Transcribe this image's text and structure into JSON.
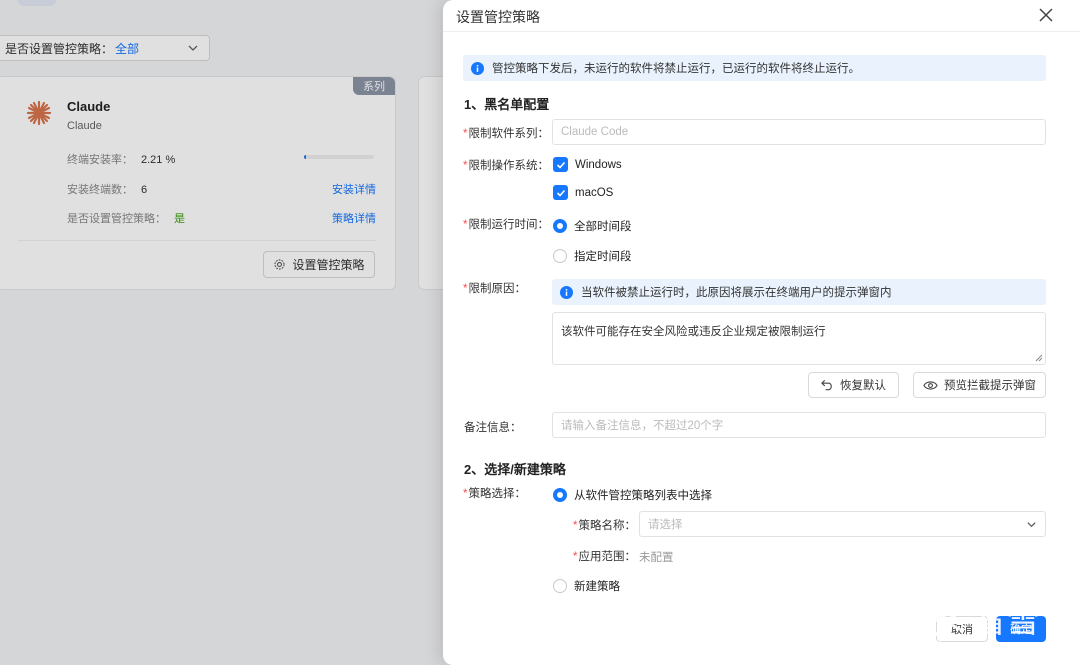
{
  "background": {
    "filter": {
      "label": "是否设置管控策略：",
      "value": "全部"
    },
    "card": {
      "tag": "系列",
      "name": "Claude",
      "subtitle": "Claude",
      "install_rate_label": "终端安装率：",
      "install_rate_value": "2.21 %",
      "install_rate_fraction": 0.0221,
      "install_count_label": "安装终端数：",
      "install_count_value": "6",
      "install_details_link": "安装详情",
      "policy_set_label": "是否设置管控策略：",
      "policy_set_value": "是",
      "policy_details_link": "策略详情",
      "set_policy_button": "设置管控策略"
    }
  },
  "drawer": {
    "title": "设置管控策略",
    "notice": "管控策略下发后，未运行的软件将禁止运行，已运行的软件将终止运行。",
    "section1_title": "1、黑名单配置",
    "software_series_label": "限制软件系列：",
    "software_series_placeholder": "Claude Code",
    "os_label": "限制操作系统：",
    "os_options": [
      {
        "label": "Windows",
        "checked": true
      },
      {
        "label": "macOS",
        "checked": true
      }
    ],
    "runtime_label": "限制运行时间：",
    "runtime_options": [
      {
        "label": "全部时间段",
        "selected": true
      },
      {
        "label": "指定时间段",
        "selected": false
      }
    ],
    "reason_label": "限制原因：",
    "reason_hint": "当软件被禁止运行时，此原因将展示在终端用户的提示弹窗内",
    "reason_value": "该软件可能存在安全风险或违反企业规定被限制运行",
    "restore_default_button": "恢复默认",
    "preview_popup_button": "预览拦截提示弹窗",
    "remark_label": "备注信息：",
    "remark_placeholder": "请输入备注信息，不超过20个字",
    "section2_title": "2、选择/新建策略",
    "policy_choice_label": "策略选择：",
    "policy_from_list_option": "从软件管控策略列表中选择",
    "policy_name_label": "策略名称：",
    "policy_name_placeholder": "请选择",
    "scope_label": "应用范围：",
    "scope_value": "未配置",
    "new_policy_option": "新建策略",
    "cancel_button": "取消",
    "confirm_button": "确定"
  },
  "watermark": {
    "text": "看雪"
  },
  "colors": {
    "primary": "#1677ff",
    "required": "#ff4d4f",
    "success": "#389e0d",
    "alert_bg": "#eaf3fd"
  }
}
